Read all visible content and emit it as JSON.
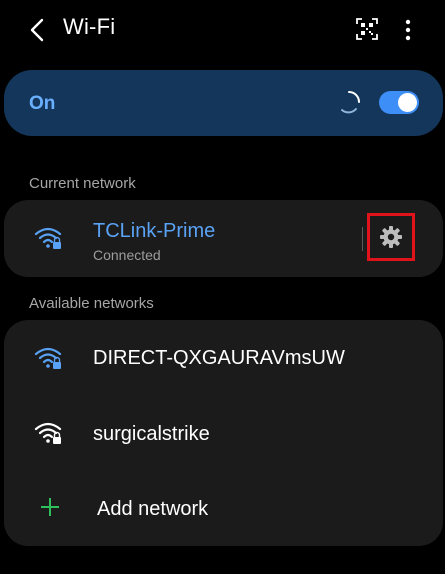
{
  "header": {
    "title": "Wi-Fi",
    "back_icon": "back-arrow-icon",
    "qr_icon": "qr-code-icon",
    "more_icon": "more-vertical-icon"
  },
  "wifi_toggle": {
    "label": "On",
    "state": true,
    "accent_color": "#3e8ef7",
    "card_color": "#13365a"
  },
  "current_network": {
    "section_label": "Current network",
    "name": "TCLink-Prime",
    "status": "Connected",
    "name_color": "#5aa2f5",
    "icon": "wifi-locked-icon",
    "settings_icon": "gear-icon",
    "highlight_color": "#e0131b"
  },
  "available_networks": {
    "section_label": "Available networks",
    "items": [
      {
        "name": "DIRECT-QXGAURAVmsUW",
        "icon": "wifi-locked-icon"
      },
      {
        "name": "surgicalstrike",
        "icon": "wifi-locked-icon"
      }
    ],
    "add_label": "Add network",
    "add_icon": "plus-icon",
    "add_icon_color": "#2fbf5a"
  }
}
